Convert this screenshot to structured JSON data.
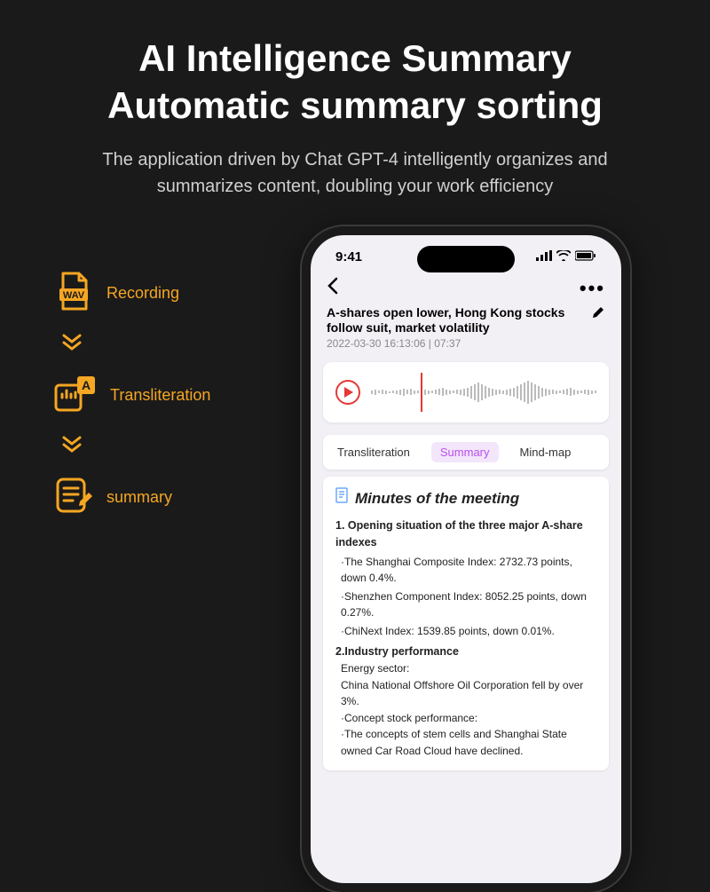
{
  "hero": {
    "title_line1": "AI Intelligence Summary",
    "title_line2": "Automatic summary sorting",
    "subtitle": "The application driven by Chat GPT-4 intelligently organizes and summarizes content, doubling your work efficiency"
  },
  "steps": {
    "recording": "Recording",
    "transliteration": "Transliteration",
    "summary": "summary",
    "wav_badge": "WAV",
    "a_badge": "A"
  },
  "phone": {
    "status": {
      "time": "9:41"
    },
    "article": {
      "title": "A-shares open lower, Hong Kong stocks follow suit, market volatility",
      "meta": "2022-03-30 16:13:06 | 07:37"
    },
    "tabs": {
      "transliteration": "Transliteration",
      "summary": "Summary",
      "mindmap": "Mind-map"
    },
    "summary": {
      "heading": "Minutes of the meeting",
      "section1_title": "1. Opening situation of the three major A-share indexes",
      "bullets1": [
        "·The Shanghai Composite Index: 2732.73 points, down 0.4%.",
        "·Shenzhen Component Index: 8052.25 points, down 0.27%.",
        "·ChiNext Index: 1539.85 points, down 0.01%."
      ],
      "section2_title": "2.Industry performance",
      "energy_label": "Energy sector:",
      "energy_line": "China National Offshore Oil Corporation fell by over 3%.",
      "concept_label": "·Concept stock performance:",
      "concept_line": "·The concepts of stem cells and Shanghai State owned Car Road Cloud have declined."
    }
  }
}
